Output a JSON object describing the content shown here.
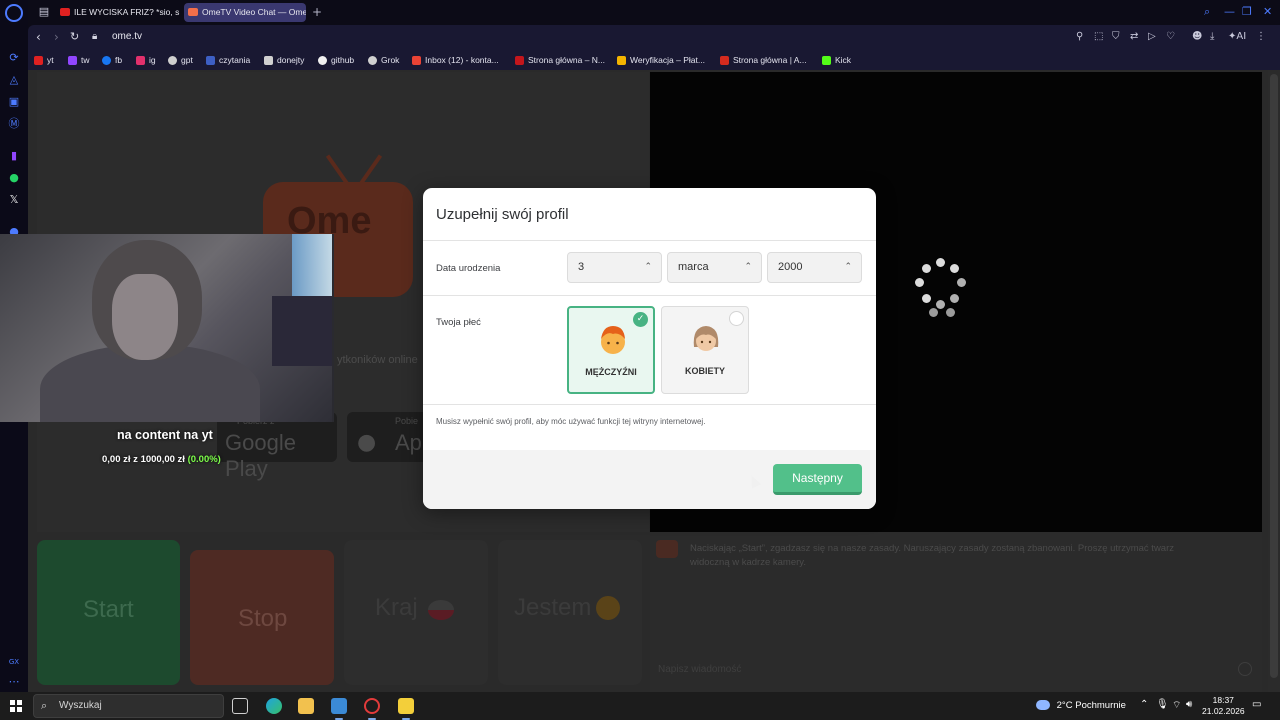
{
  "browser": {
    "tabs": [
      {
        "label": "ILE WYCISKA FRIZ? *sio, s",
        "color": "#e02121",
        "active": false
      },
      {
        "label": "OmeTV Video Chat — Ome",
        "color": "#f36f4a",
        "active": true
      }
    ],
    "new_tab_label": "+",
    "url": "ome.tv",
    "toolbar_ai_label": "AI",
    "bookmarks": [
      {
        "label": "yt",
        "color": "#e02121"
      },
      {
        "label": "tw",
        "color": "#9146ff"
      },
      {
        "label": "fb",
        "color": "#1877f2"
      },
      {
        "label": "ig",
        "color": "#e1306c"
      },
      {
        "label": "gpt",
        "color": "#cfcfcf"
      },
      {
        "label": "czytania",
        "color": "#3d5fc4"
      },
      {
        "label": "donejty",
        "color": "#d0d0d0"
      },
      {
        "label": "github",
        "color": "#f0f0f0"
      },
      {
        "label": "Grok",
        "color": "#d0d0d0"
      },
      {
        "label": "Inbox (12) - konta...",
        "color": "#ea4335"
      },
      {
        "label": "Strona główna – N...",
        "color": "#c4161c"
      },
      {
        "label": "Weryfikacja – Płat...",
        "color": "#f4b400"
      },
      {
        "label": "Strona główna | A...",
        "color": "#d52b1e"
      },
      {
        "label": "Kick",
        "color": "#53fc18"
      }
    ]
  },
  "page": {
    "online_text": "ytkoników online",
    "google_play_small": "Pobierz z",
    "google_play_big": "Google Play",
    "app_store_small": "Pobie",
    "app_store_big": "Ap",
    "controls": [
      {
        "label": "Start",
        "color": "#1d4a2e"
      },
      {
        "label": "Stop",
        "color": "#4e2a23"
      },
      {
        "label": "Kraj",
        "color": "#2d2d2d"
      },
      {
        "label": "Jestem",
        "color": "#2d2d2d"
      }
    ],
    "chat_message": "Naciskając „Start”, zgadzasz się na nasze zasady. Naruszający zasady zostaną zbanowani. Proszę utrzymać twarz widoczną w kadrze kamery.",
    "chat_placeholder": "Napisz wiadomość"
  },
  "stream_overlay": {
    "caption": "na content na yt",
    "goal_current": "0,00 zł",
    "goal_z": "z",
    "goal_target": "1000,00 zł",
    "goal_percent": "(0.00%)",
    "goal_fraction": 0.0
  },
  "modal": {
    "title": "Uzupełnij swój profil",
    "birthdate_label": "Data urodzenia",
    "day": "3",
    "month": "marca",
    "year": "2000",
    "gender_label": "Twoja płeć",
    "genders": [
      {
        "label": "MĘŻCZYŹNI",
        "selected": true
      },
      {
        "label": "KOBIETY",
        "selected": false
      }
    ],
    "note": "Musisz wypełnić swój profil, aby móc używać funkcji tej witryny internetowej.",
    "next_label": "Następny",
    "accent_color": "#52c08a"
  },
  "taskbar": {
    "search_placeholder": "Wyszukaj",
    "temperature": "2°C",
    "weather": "Pochmurnie",
    "time": "18:37",
    "date": "21.02.2026"
  }
}
